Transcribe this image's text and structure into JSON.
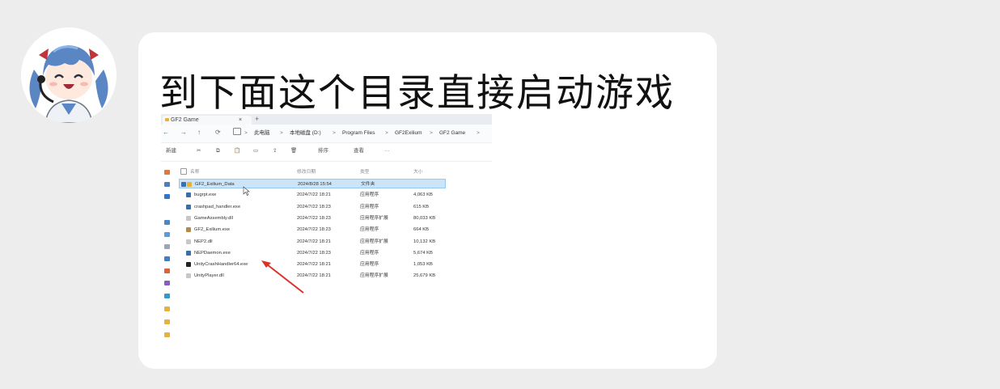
{
  "message": {
    "text": "到下面这个目录直接启动游戏"
  },
  "avatar": {
    "icon": "anime-girl-avatar"
  },
  "explorer": {
    "tab_title": "GF2 Game",
    "tab_close": "×",
    "new_tab": "+",
    "nav": {
      "back": "←",
      "forward": "→",
      "up": "↑",
      "refresh": "⟳"
    },
    "breadcrumb": [
      "此电脑",
      "本地磁盘 (D:)",
      "Program Files",
      "GF2Exilium",
      "GF2 Game"
    ],
    "breadcrumb_sep": ">",
    "toolbar": {
      "new": "新建",
      "cut": "✂",
      "copy": "⧉",
      "paste": "📋",
      "rename": "▭",
      "share": "⇪",
      "delete": "🗑",
      "sort": "排序",
      "view": "查看",
      "more": "···"
    },
    "columns": {
      "name": "名称",
      "date": "修改日期",
      "type": "类型",
      "size": "大小"
    },
    "files": [
      {
        "name": "GF2_Exilium_Data",
        "date": "2024/8/28 15:54",
        "type": "文件夹",
        "size": "",
        "icon_color": "#e6b33a",
        "selected": true
      },
      {
        "name": "bugrpt.exe",
        "date": "2024/7/22 18:21",
        "type": "应用程序",
        "size": "4,063 KB",
        "icon_color": "#3a6ea8",
        "selected": false
      },
      {
        "name": "crashpad_handler.exe",
        "date": "2024/7/22 18:23",
        "type": "应用程序",
        "size": "615 KB",
        "icon_color": "#3a6ea8",
        "selected": false
      },
      {
        "name": "GameAssembly.dll",
        "date": "2024/7/22 18:23",
        "type": "应用程序扩展",
        "size": "80,033 KB",
        "icon_color": "#c7c7c7",
        "selected": false
      },
      {
        "name": "GF2_Exilium.exe",
        "date": "2024/7/22 18:23",
        "type": "应用程序",
        "size": "664 KB",
        "icon_color": "#b38a4a",
        "selected": false
      },
      {
        "name": "NEP2.dll",
        "date": "2024/7/22 18:21",
        "type": "应用程序扩展",
        "size": "10,132 KB",
        "icon_color": "#c7c7c7",
        "selected": false
      },
      {
        "name": "NEPDaemon.exe",
        "date": "2024/7/22 18:23",
        "type": "应用程序",
        "size": "5,674 KB",
        "icon_color": "#3a6ea8",
        "selected": false
      },
      {
        "name": "UnityCrashHandler64.exe",
        "date": "2024/7/22 18:21",
        "type": "应用程序",
        "size": "1,053 KB",
        "icon_color": "#222222",
        "selected": false
      },
      {
        "name": "UnityPlayer.dll",
        "date": "2024/7/22 18:21",
        "type": "应用程序扩展",
        "size": "25,679 KB",
        "icon_color": "#c7c7c7",
        "selected": false
      }
    ],
    "annotation_arrow_color": "#d9322b"
  }
}
